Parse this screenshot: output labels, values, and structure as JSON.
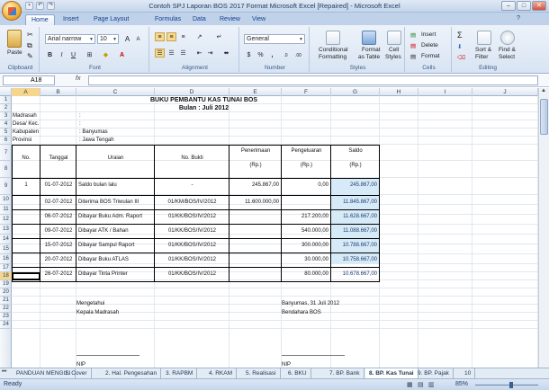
{
  "window": {
    "title": "Contoh SPJ Laporan BOS 2017 Format Microsoft Excel [Repaired] - Microsoft Excel",
    "minimize": "–",
    "maximize": "□",
    "close": "✕"
  },
  "ribbon_tabs": [
    "Home",
    "Insert",
    "Page Layout",
    "Formulas",
    "Data",
    "Review",
    "View"
  ],
  "ribbon": {
    "clipboard": {
      "paste": "Paste",
      "label": "Clipboard"
    },
    "font": {
      "name": "Arial narrow",
      "size": "10",
      "bold": "B",
      "italic": "I",
      "underline": "U",
      "grow": "A",
      "shrink": "A",
      "color_a": "A",
      "label": "Font"
    },
    "alignment": {
      "label": "Alignment"
    },
    "number": {
      "format": "General",
      "currency": "$",
      "percent": "%",
      "comma": ",",
      "inc": ".0",
      "dec": ".00",
      "label": "Number"
    },
    "styles": {
      "conditional": "Conditional",
      "conditional2": "Formatting",
      "format_table": "Format",
      "format_table2": "as Table",
      "cell_styles": "Cell",
      "cell_styles2": "Styles",
      "label": "Styles"
    },
    "cells": {
      "insert": "Insert",
      "delete": "Delete",
      "format": "Format",
      "label": "Cells"
    },
    "editing": {
      "sum": "Σ",
      "sort": "Sort &",
      "sort2": "Filter",
      "find": "Find &",
      "find2": "Select",
      "label": "Editing"
    }
  },
  "formula_bar": {
    "name_box": "A18",
    "fx": "fx",
    "content": ""
  },
  "columns": [
    "A",
    "B",
    "C",
    "D",
    "E",
    "F",
    "G",
    "H",
    "I",
    "J"
  ],
  "rows": [
    "1",
    "2",
    "3",
    "4",
    "5",
    "6",
    "7",
    "8",
    "9",
    "10",
    "11",
    "12",
    "13",
    "14",
    "15",
    "16",
    "17",
    "18",
    "19",
    "20",
    "21",
    "22",
    "23",
    "24"
  ],
  "sheet": {
    "title": "BUKU PEMBANTU KAS TUNAI BOS",
    "subtitle": "Bulan : Juli 2012",
    "info": [
      {
        "label": "Madrasah",
        "value": ":"
      },
      {
        "label": "Desa/ Kec.",
        "value": ":"
      },
      {
        "label": "Kabupaten",
        "value": ": Banyumas"
      },
      {
        "label": "Provinsi",
        "value": ": Jawa Tengah"
      }
    ],
    "headers": {
      "no": "No.",
      "tanggal": "Tanggal",
      "uraian": "Uraian",
      "bukti": "No. Bukti",
      "penerimaan": "Penerimaan",
      "pengeluaran": "Pengeluaran",
      "saldo": "Saldo",
      "rp1": "(Rp.)",
      "rp2": "(Rp.)",
      "rp3": "(Rp.)"
    },
    "entries": [
      {
        "no": "1",
        "tanggal": "01-07-2012",
        "uraian": "Saldo bulan lalu",
        "bukti": "-",
        "penerimaan": "245.867,00",
        "pengeluaran": "0,00",
        "saldo": "245.867,00"
      },
      {
        "no": "",
        "tanggal": "02-07-2012",
        "uraian": "Diterima BOS Triwulan III",
        "bukti": "01/KM/BOS/IV/2012",
        "penerimaan": "11.600.000,00",
        "pengeluaran": "",
        "saldo": "11.845.867,00"
      },
      {
        "no": "",
        "tanggal": "06-07-2012",
        "uraian": "Dibayar Buku Adm. Raport",
        "bukti": "01/KK/BOS/IV/2012",
        "penerimaan": "",
        "pengeluaran": "217.200,00",
        "saldo": "11.628.667,00"
      },
      {
        "no": "",
        "tanggal": "09-07-2012",
        "uraian": "Dibayar ATK / Bahan",
        "bukti": "01/KK/BOS/IV/2012",
        "penerimaan": "",
        "pengeluaran": "540.000,00",
        "saldo": "11.088.667,00"
      },
      {
        "no": "",
        "tanggal": "15-07-2012",
        "uraian": "Dibayar Sampul Raport",
        "bukti": "01/KK/BOS/IV/2012",
        "penerimaan": "",
        "pengeluaran": "300.000,00",
        "saldo": "10.788.667,00"
      },
      {
        "no": "",
        "tanggal": "20-07-2012",
        "uraian": "Dibayar Buku ATLAS",
        "bukti": "01/KK/BOS/IV/2012",
        "penerimaan": "",
        "pengeluaran": "30.000,00",
        "saldo": "10.758.667,00"
      },
      {
        "no": "",
        "tanggal": "26-07-2012",
        "uraian": "Dibayar Tinta Printer",
        "bukti": "01/KK/BOS/IV/2012",
        "penerimaan": "",
        "pengeluaran": "80.000,00",
        "saldo": "10.678.667,00"
      }
    ],
    "footer": {
      "left1": "Mengetahui",
      "left2": "Kepala Madrasah",
      "right1": "Banyumas, 31 Juli 2012",
      "right2": "Bendahara BOS",
      "nip_left": "NIP",
      "nip_right": "NIP"
    }
  },
  "sheet_tabs": [
    "PANDUAN MENGISI",
    "1. Cover",
    "2. Hal. Pengesahan",
    "3. RAPBM",
    "4. RKAM",
    "5. Realisasi",
    "6. BKU",
    "7. BP. Bank",
    "8. BP. Kas Tunai",
    "9. BP. Pajak",
    "10"
  ],
  "active_tab": "8. BP. Kas Tunai",
  "status": {
    "ready": "Ready",
    "zoom": "85%"
  },
  "colors": {
    "saldo_fill": "#d7eaf7",
    "tab_text": "#15428b"
  }
}
